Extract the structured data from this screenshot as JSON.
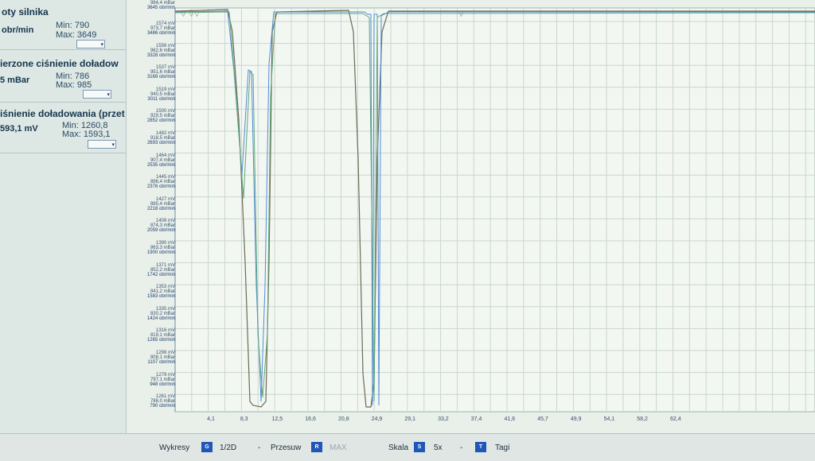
{
  "params": [
    {
      "title": "oty silnika",
      "value": "obr/min",
      "min": "Min: 790",
      "max": "Max: 3649"
    },
    {
      "title": "ierzone ciśnienie doładow",
      "value": "5 mBar",
      "min": "Min: 786",
      "max": "Max: 985"
    },
    {
      "title": "iśnienie doładowania (przet",
      "value": "593,1 mV",
      "min": "Min: 1260,8",
      "max": "Max: 1593,1"
    }
  ],
  "y_label_rows": [
    [
      "1574 mV",
      "973,7 mBar",
      "3486 obr/min"
    ],
    [
      "1556 mV",
      "962,6 mBar",
      "3328 obr/min"
    ],
    [
      "1537 mV",
      "951,6 mBar",
      "3169 obr/min"
    ],
    [
      "1519 mV",
      "940,5 mBar",
      "3011 obr/min"
    ],
    [
      "1500 mV",
      "929,5 mBar",
      "2852 obr/min"
    ],
    [
      "1482 mV",
      "918,5 mBar",
      "2693 obr/min"
    ],
    [
      "1464 mV",
      "907,4 mBar",
      "2535 obr/min"
    ],
    [
      "1445 mV",
      "896,4 mBar",
      "2376 obr/min"
    ],
    [
      "1427 mV",
      "885,4 mBar",
      "2218 obr/min"
    ],
    [
      "1408 mV",
      "874,3 mBar",
      "2059 obr/min"
    ],
    [
      "1390 mV",
      "863,3 mBar",
      "1900 obr/min"
    ],
    [
      "1371 mV",
      "852,2 mBar",
      "1742 obr/min"
    ],
    [
      "1353 mV",
      "841,2 mBar",
      "1583 obr/min"
    ],
    [
      "1335 mV",
      "830,2 mBar",
      "1424 obr/min"
    ],
    [
      "1316 mV",
      "819,1 mBar",
      "1265 obr/min"
    ],
    [
      "1298 mV",
      "808,1 mBar",
      "1107 obr/min"
    ],
    [
      "1279 mV",
      "797,1 mBar",
      "948 obr/min"
    ],
    [
      "1261 mV",
      "786,0 mBar",
      "790 obr/min"
    ]
  ],
  "top_readout": {
    "mbar": "984,4 mBar",
    "rpm": "3645 obr/min"
  },
  "x_ticks": [
    "4,1",
    "8,3",
    "12,5",
    "16,6",
    "20,8",
    "24,9",
    "29,1",
    "33,2",
    "37,4",
    "41,6",
    "45,7",
    "49,9",
    "54,1",
    "58,2",
    "62,4"
  ],
  "toolbar": {
    "wykresy_label": "Wykresy",
    "wykresy_key": "G",
    "wykresy_value": "1/2D",
    "przesuw_dash": "-",
    "przesuw_label": "Przesuw",
    "przesuw_key": "R",
    "przesuw_value": "MAX",
    "skala_label": "Skala",
    "skala_key": "S",
    "skala_value": "5x",
    "skala_dash": "-",
    "tagi_key": "T",
    "tagi_label": "Tagi"
  },
  "colors": {
    "series_rpm": "#6d6a52",
    "series_boost_measured": "#4f8bd6",
    "series_boost_requested": "#5fa77a",
    "grid": "#c8d6cf",
    "plot_bg": "#f3f7f2",
    "toolbar_key": "#1f56b8"
  }
}
